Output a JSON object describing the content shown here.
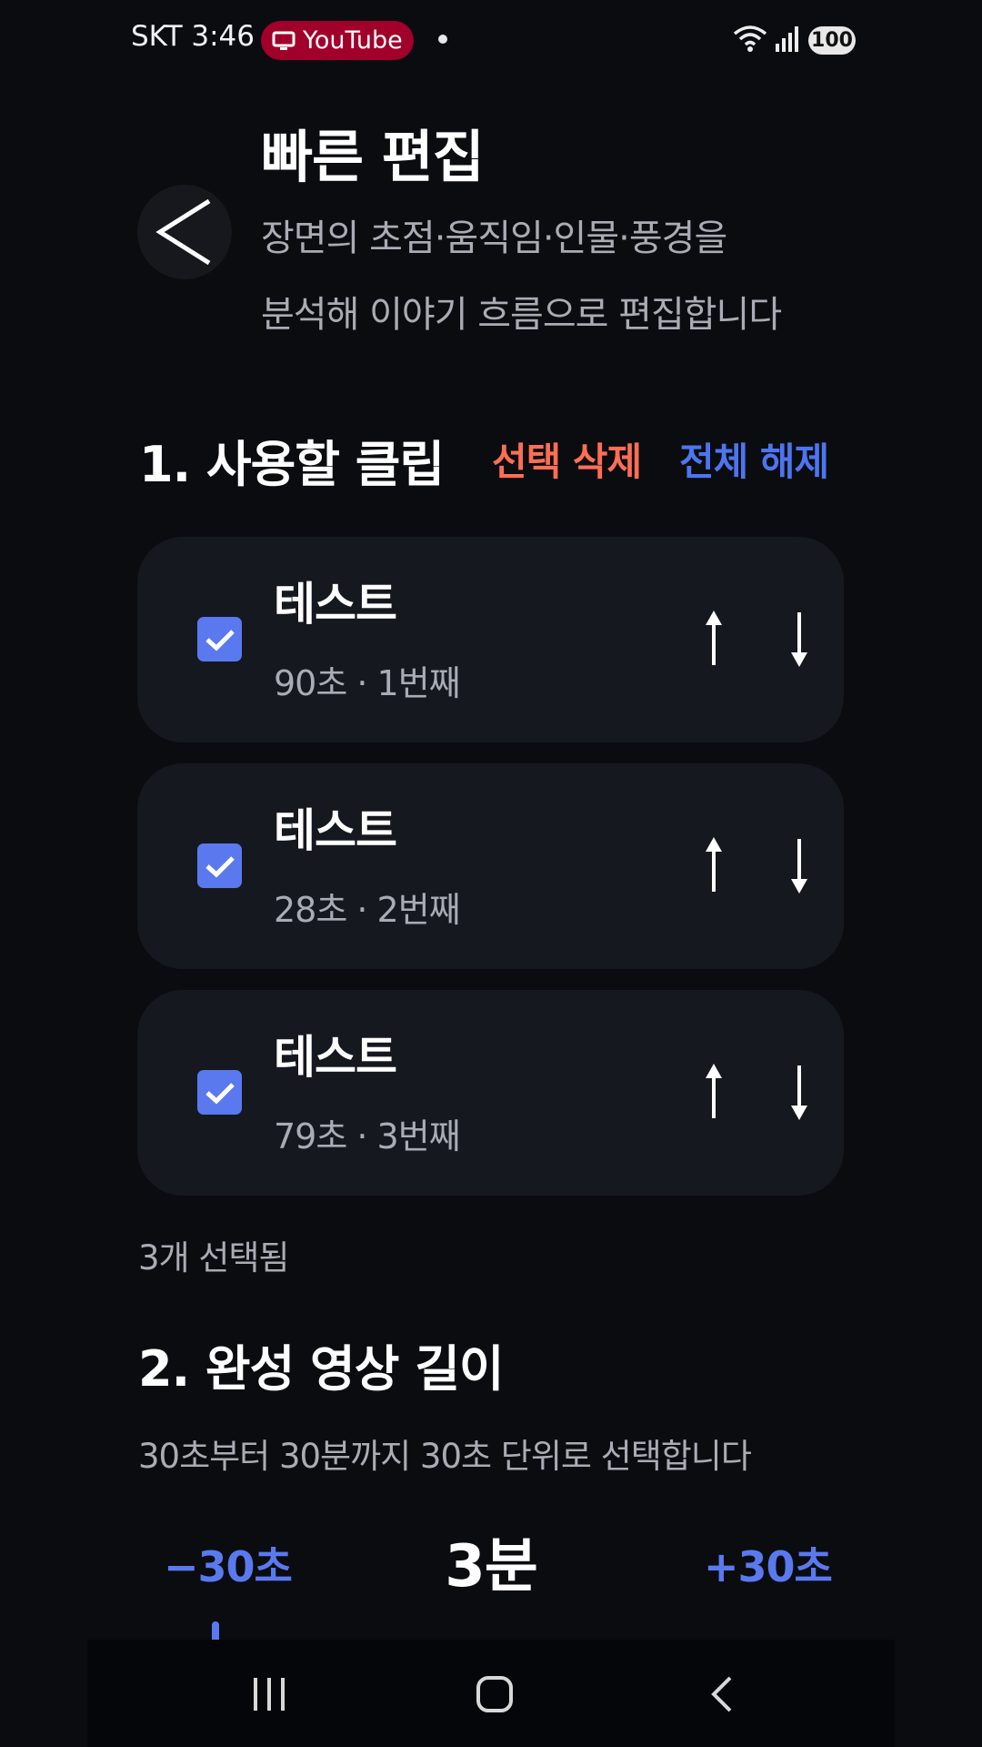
{
  "status_bar": {
    "carrier_time": "SKT 3:46",
    "pill_label": "YouTube",
    "battery": "100"
  },
  "header": {
    "title": "빠른 편집",
    "description_line1": "장면의 초점·움직임·인물·풍경을",
    "description_line2": "분석해 이야기 흐름으로 편집합니다"
  },
  "clips_section": {
    "title": "1. 사용할 클립",
    "delete_label": "선택 삭제",
    "clear_label": "전체 해제",
    "clips": [
      {
        "title": "테스트",
        "meta": "90초 · 1번째",
        "checked": true
      },
      {
        "title": "테스트",
        "meta": "28초 · 2번째",
        "checked": true
      },
      {
        "title": "테스트",
        "meta": "79초 · 3번째",
        "checked": true
      }
    ],
    "selected_count": "3개 선택됨"
  },
  "length_section": {
    "title": "2. 완성 영상 길이",
    "description": "30초부터 30분까지 30초 단위로 선택합니다",
    "minus_label": "−30초",
    "value": "3분",
    "plus_label": "+30초"
  },
  "colors": {
    "background": "#0b0c10",
    "card": "#16181f",
    "accent_blue": "#5b79ee",
    "danger": "#ff6e55",
    "pill_red": "#a0002a"
  },
  "icons": [
    "back-arrow-icon",
    "check-icon",
    "arrow-up-icon",
    "arrow-down-icon",
    "wifi-icon",
    "signal-icon",
    "recents-icon",
    "home-icon",
    "nav-back-icon"
  ]
}
